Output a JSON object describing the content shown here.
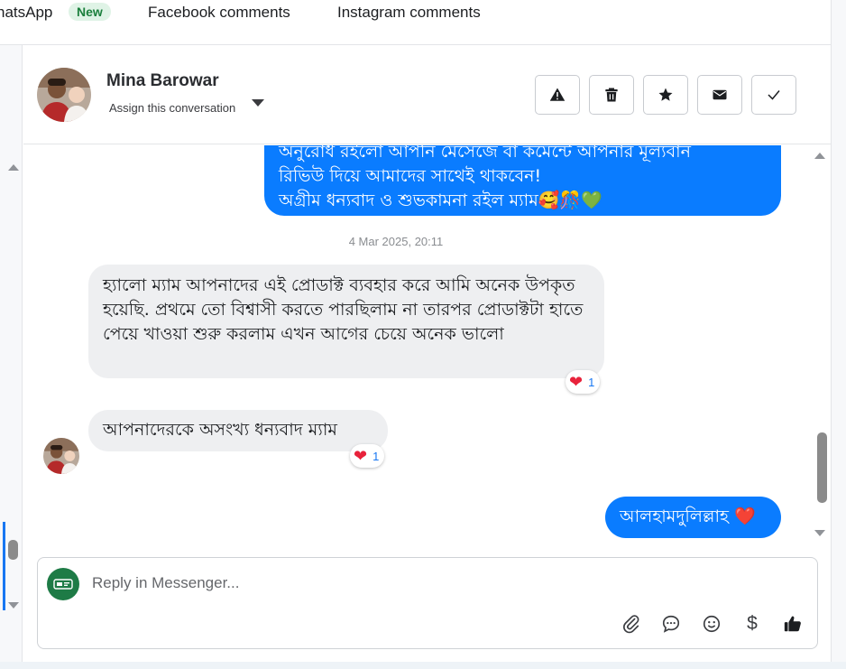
{
  "tabs": {
    "whatsapp": "hatsApp",
    "whatsapp_badge": "New",
    "facebook": "Facebook comments",
    "instagram": "Instagram comments"
  },
  "header": {
    "contact_name": "Mina Barowar",
    "assign_label": "Assign this conversation",
    "actions": [
      "warning-icon",
      "trash-icon",
      "star-icon",
      "envelope-icon",
      "check-icon"
    ]
  },
  "messages": {
    "outgoing_top_line1": "অনুরোধ রইলো আপনি মেসেজে বা কমেন্টে আপনার মূল্যবান",
    "outgoing_top_line2": "রিভিউ দিয়ে আমাদের সাথেই থাকবেন!",
    "outgoing_top_line3": "অগ্রীম ধন্যবাদ ও শুভকামনা রইল ম্যাম🥰🎊💚",
    "timestamp": "4 Mar 2025, 20:11",
    "incoming_1": "হ্যালো ম্যাম আপনাদের এই প্রোডাক্ট ব্যবহার করে আমি অনেক উপকৃত হয়েছি. প্রথমে তো বিশ্বাসী করতে পারছিলাম না তারপর প্রোডাক্টটা হাতে পেয়ে খাওয়া শুরু করলাম এখন আগের চেয়ে অনেক ভালো",
    "incoming_1_reaction_count": "1",
    "incoming_2": "আপনাদেরকে অসংখ্য ধন্যবাদ ম্যাম",
    "incoming_2_reaction_count": "1",
    "outgoing_2": "আলহামদুলিল্লাহ ❤️"
  },
  "composer": {
    "placeholder": "Reply in Messenger...",
    "icons": [
      "paperclip-icon",
      "comment-icon",
      "emoji-icon",
      "dollar-icon",
      "thumbs-up-icon"
    ],
    "dollar_glyph": "$"
  },
  "colors": {
    "outgoing_bubble": "#0a7cff",
    "incoming_bubble": "#eeeff1",
    "accent": "#1877f2",
    "new_badge_bg": "#dff3e6",
    "new_badge_text": "#1a7f3c",
    "page_avatar": "#1e7b46"
  }
}
